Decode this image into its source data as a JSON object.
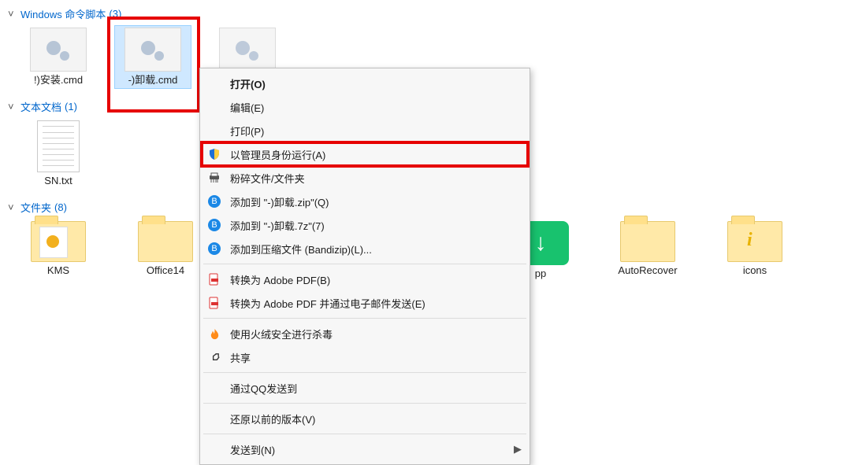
{
  "groups": {
    "cmd": {
      "label": "Windows 命令脚本",
      "count": 3
    },
    "txt": {
      "label": "文本文档",
      "count": 1
    },
    "folder": {
      "label": "文件夹",
      "count": 8
    }
  },
  "files": {
    "cmd1": {
      "label": "!)安装.cmd"
    },
    "cmd2": {
      "label": "-)卸载.cmd"
    },
    "txt1": {
      "label": "SN.txt"
    },
    "fld_kms": {
      "label": "KMS"
    },
    "fld_off": {
      "label": "Office14"
    },
    "fld_app": {
      "label": "pp"
    },
    "fld_ar": {
      "label": "AutoRecover"
    },
    "fld_icons": {
      "label": "icons"
    }
  },
  "menu": {
    "open": "打开(O)",
    "edit": "编辑(E)",
    "print": "打印(P)",
    "runadmin": "以管理员身份运行(A)",
    "shred": "粉碎文件/文件夹",
    "addzip": "添加到 \"-)卸载.zip\"(Q)",
    "add7z": "添加到 \"-)卸载.7z\"(7)",
    "addbz": "添加到压缩文件 (Bandizip)(L)...",
    "pdf": "转换为 Adobe PDF(B)",
    "pdfemail": "转换为 Adobe PDF 并通过电子邮件发送(E)",
    "huorong": "使用火绒安全进行杀毒",
    "share": "共享",
    "sendqq": "通过QQ发送到",
    "restore": "还原以前的版本(V)",
    "sendto": "发送到(N)"
  }
}
